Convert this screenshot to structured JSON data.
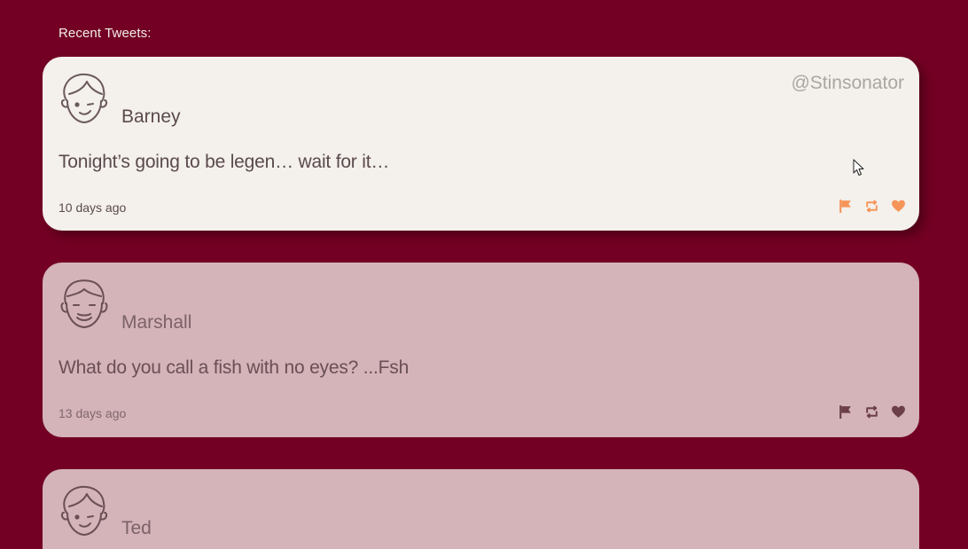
{
  "section": {
    "title": "Recent Tweets:"
  },
  "colors": {
    "background": "#730024",
    "card_active": "#f4f0eb",
    "card_inactive": "#d4b3b9",
    "accent_active": "#f5955a",
    "accent_inactive": "#6b3f47"
  },
  "tweets": [
    {
      "name": "Barney",
      "handle": "@Stinsonator",
      "text": "Tonight’s going to be legen… wait for it…",
      "time": "10 days ago",
      "avatar_icon": "winking-face-icon",
      "actions": [
        "flag-icon",
        "retweet-icon",
        "heart-icon"
      ]
    },
    {
      "name": "Marshall",
      "handle": "",
      "text": "What do you call a fish with no eyes? ...Fsh",
      "time": "13 days ago",
      "avatar_icon": "smiling-face-icon",
      "actions": [
        "flag-icon",
        "retweet-icon",
        "heart-icon"
      ]
    },
    {
      "name": "Ted",
      "handle": "",
      "text": "",
      "time": "",
      "avatar_icon": "winking-face-icon",
      "actions": []
    }
  ]
}
